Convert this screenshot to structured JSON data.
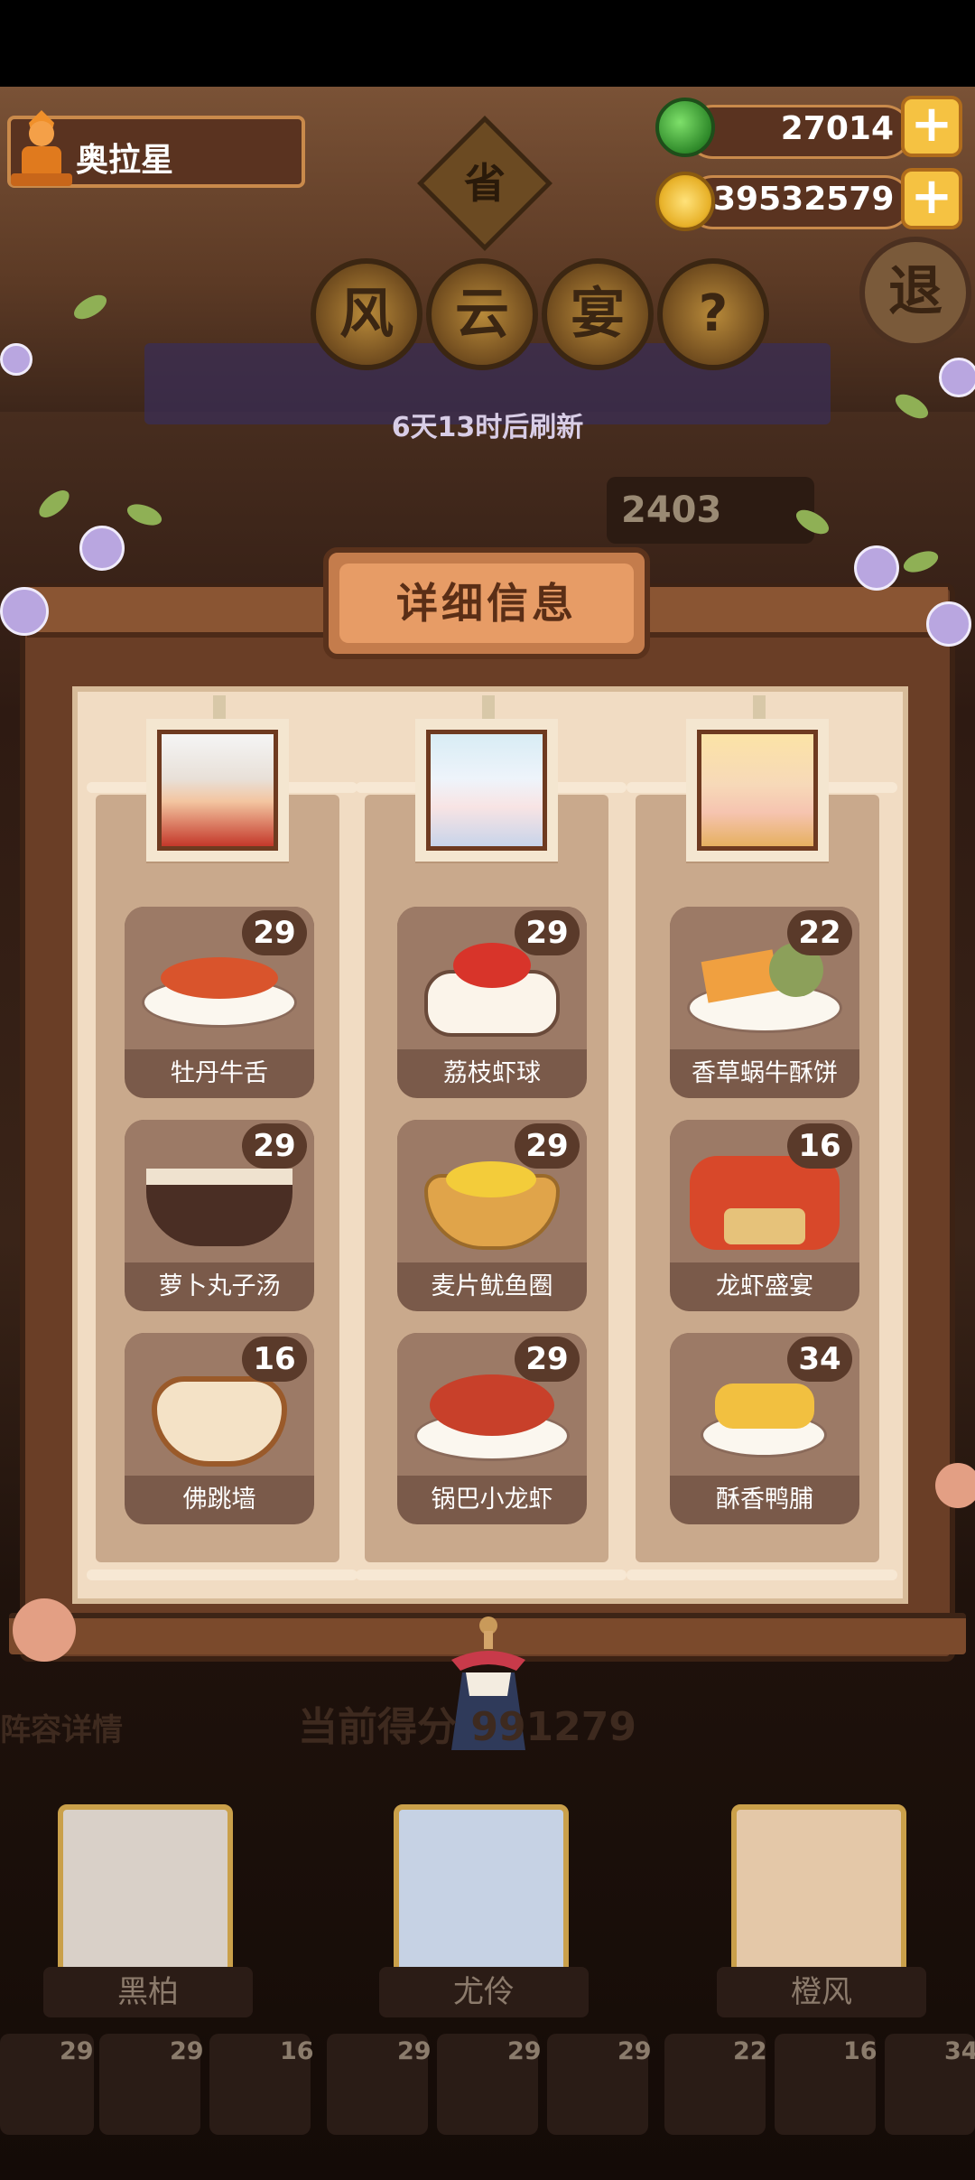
{
  "header": {
    "player_name": "奥拉星",
    "currencies": [
      {
        "icon": "jade-coin-icon",
        "value": "27014"
      },
      {
        "icon": "gold-coin-icon",
        "value": "39532579"
      }
    ],
    "plus_glyph": "+",
    "province_char": "省",
    "title_chars": [
      "风",
      "云",
      "宴"
    ],
    "help_glyph": "?",
    "exit_char": "退",
    "refresh_text": "6天13时后刷新",
    "score_partial": "2403"
  },
  "panel": {
    "title": "详细信息",
    "columns": [
      {
        "character_avatar": "character-portrait-icon",
        "dishes": [
          {
            "name": "牡丹牛舌",
            "count": "29"
          },
          {
            "name": "萝卜丸子汤",
            "count": "29"
          },
          {
            "name": "佛跳墙",
            "count": "16"
          }
        ]
      },
      {
        "character_avatar": "character-portrait-icon",
        "dishes": [
          {
            "name": "荔枝虾球",
            "count": "29"
          },
          {
            "name": "麦片鱿鱼圈",
            "count": "29"
          },
          {
            "name": "锅巴小龙虾",
            "count": "29"
          }
        ]
      },
      {
        "character_avatar": "character-portrait-icon",
        "dishes": [
          {
            "name": "香草蜗牛酥饼",
            "count": "22"
          },
          {
            "name": "龙虾盛宴",
            "count": "16"
          },
          {
            "name": "酥香鸭脯",
            "count": "34"
          }
        ]
      }
    ]
  },
  "lower": {
    "lineup_label": "阵容详情",
    "score_label": "当前得分",
    "score_value": "991279",
    "characters": [
      "黑柏",
      "尤伶",
      "橙风"
    ],
    "bottom_counts": [
      "29",
      "29",
      "16",
      "29",
      "29",
      "29",
      "22",
      "16",
      "34"
    ]
  },
  "colors": {
    "accent_gold": "#f5c242",
    "panel_wood": "#6a3e26",
    "card_brown": "#7a5a4a",
    "count_badge": "#5a3a2a"
  }
}
